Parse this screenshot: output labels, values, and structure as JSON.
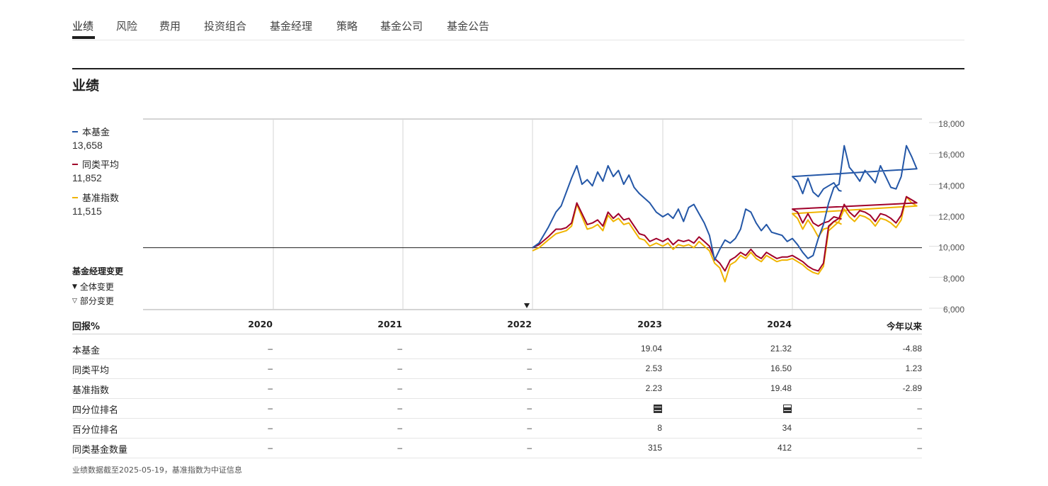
{
  "tabs": [
    "业绩",
    "风险",
    "费用",
    "投资组合",
    "基金经理",
    "策略",
    "基金公司",
    "基金公告"
  ],
  "section_title": "业绩",
  "legend": [
    {
      "name": "本基金",
      "value": "13,658",
      "color": "#2457a7"
    },
    {
      "name": "同类平均",
      "value": "11,852",
      "color": "#a0002a"
    },
    {
      "name": "基准指数",
      "value": "11,515",
      "color": "#f0b400"
    }
  ],
  "manager_change": {
    "title": "基金经理变更",
    "full": "全体变更",
    "partial": "部分变更",
    "full_marker_year": "2022"
  },
  "chart_data": {
    "type": "line",
    "x_labels": [
      "2020",
      "2021",
      "2022",
      "2023",
      "2024",
      "今年以来"
    ],
    "y_ticks": [
      "18,000",
      "16,000",
      "14,000",
      "12,000",
      "10,000",
      "8,000",
      "6,000"
    ],
    "ylim": [
      6000,
      18000
    ],
    "baseline": 10000,
    "series": [
      {
        "name": "本基金",
        "color": "#2457a7",
        "x": [
          2022.0,
          2022.05,
          2022.12,
          2022.18,
          2022.22,
          2022.26,
          2022.3,
          2022.34,
          2022.38,
          2022.42,
          2022.46,
          2022.5,
          2022.54,
          2022.58,
          2022.62,
          2022.66,
          2022.7,
          2022.74,
          2022.78,
          2022.82,
          2022.86,
          2022.9,
          2022.95,
          2023.0,
          2023.04,
          2023.08,
          2023.12,
          2023.16,
          2023.2,
          2023.24,
          2023.28,
          2023.32,
          2023.36,
          2023.4,
          2023.44,
          2023.48,
          2023.52,
          2023.56,
          2023.6,
          2023.64,
          2023.68,
          2023.72,
          2023.76,
          2023.8,
          2023.84,
          2023.88,
          2023.92,
          2023.96,
          2024.0,
          2024.04,
          2024.08,
          2024.12,
          2024.16,
          2024.2,
          2024.24,
          2024.28,
          2024.32,
          2024.36,
          2024.4,
          2024.44,
          2024.48,
          2024.52,
          2024.56,
          2024.6,
          2024.64,
          2024.68,
          2024.72,
          2024.76,
          2024.8,
          2024.84,
          2024.88,
          2024.92,
          2024.96,
          2025.0,
          2025.04,
          2025.08,
          2025.12,
          2025.16,
          2025.2,
          2025.24,
          2025.28,
          2025.32,
          2025.36,
          2025.38
        ],
        "y": [
          10000,
          10300,
          11300,
          12300,
          12700,
          13600,
          14500,
          15300,
          14100,
          14400,
          14000,
          14900,
          14300,
          15300,
          14600,
          15000,
          14100,
          14700,
          13900,
          13500,
          13200,
          12900,
          12300,
          12000,
          12200,
          11900,
          12500,
          11700,
          12600,
          12800,
          12200,
          11600,
          10800,
          9200,
          9900,
          10500,
          10300,
          10600,
          11200,
          12500,
          12300,
          11600,
          11100,
          11500,
          11000,
          10900,
          10800,
          10400,
          10600,
          10200,
          9700,
          9300,
          9500,
          10600,
          11500,
          12900,
          13900,
          14100,
          16600,
          15200,
          14800,
          14300,
          15000,
          14600,
          14200,
          15300,
          14600,
          13900,
          13800,
          14600,
          16600,
          15900,
          15100,
          14600,
          14300,
          13500,
          14500,
          13600,
          13300,
          13800,
          14000,
          14200,
          13700,
          13658
        ]
      },
      {
        "name": "同类平均",
        "color": "#a0002a",
        "x": [
          2022.0,
          2022.05,
          2022.12,
          2022.18,
          2022.22,
          2022.26,
          2022.3,
          2022.34,
          2022.38,
          2022.42,
          2022.46,
          2022.5,
          2022.54,
          2022.58,
          2022.62,
          2022.66,
          2022.7,
          2022.74,
          2022.78,
          2022.82,
          2022.86,
          2022.9,
          2022.95,
          2023.0,
          2023.04,
          2023.08,
          2023.12,
          2023.16,
          2023.2,
          2023.24,
          2023.28,
          2023.32,
          2023.36,
          2023.4,
          2023.44,
          2023.48,
          2023.52,
          2023.56,
          2023.6,
          2023.64,
          2023.68,
          2023.72,
          2023.76,
          2023.8,
          2023.84,
          2023.88,
          2023.92,
          2023.96,
          2024.0,
          2024.04,
          2024.08,
          2024.12,
          2024.16,
          2024.2,
          2024.24,
          2024.28,
          2024.32,
          2024.36,
          2024.4,
          2024.44,
          2024.48,
          2024.52,
          2024.56,
          2024.6,
          2024.64,
          2024.68,
          2024.72,
          2024.76,
          2024.8,
          2024.84,
          2024.88,
          2024.92,
          2024.96,
          2025.0,
          2025.04,
          2025.08,
          2025.12,
          2025.16,
          2025.2,
          2025.24,
          2025.28,
          2025.32,
          2025.36,
          2025.38
        ],
        "y": [
          10000,
          10200,
          10700,
          11200,
          11200,
          11300,
          11600,
          12900,
          12200,
          11500,
          11600,
          11800,
          11400,
          12300,
          11900,
          12200,
          11800,
          11900,
          11400,
          10900,
          10800,
          10400,
          10600,
          10400,
          10600,
          10200,
          10500,
          10400,
          10500,
          10300,
          10700,
          10400,
          10100,
          9300,
          9000,
          8500,
          9200,
          9400,
          9700,
          9500,
          9900,
          9500,
          9300,
          9700,
          9500,
          9300,
          9400,
          9400,
          9500,
          9300,
          9100,
          8800,
          8600,
          8500,
          9000,
          11400,
          11700,
          11900,
          12800,
          12300,
          12000,
          12400,
          12300,
          12100,
          11700,
          12200,
          12100,
          11900,
          11600,
          12100,
          13300,
          13100,
          12900,
          12500,
          12300,
          11600,
          12200,
          11600,
          11400,
          11600,
          11700,
          12000,
          11900,
          11852
        ]
      },
      {
        "name": "基准指数",
        "color": "#f0b400",
        "x": [
          2022.0,
          2022.05,
          2022.12,
          2022.18,
          2022.22,
          2022.26,
          2022.3,
          2022.34,
          2022.38,
          2022.42,
          2022.46,
          2022.5,
          2022.54,
          2022.58,
          2022.62,
          2022.66,
          2022.7,
          2022.74,
          2022.78,
          2022.82,
          2022.86,
          2022.9,
          2022.95,
          2023.0,
          2023.04,
          2023.08,
          2023.12,
          2023.16,
          2023.2,
          2023.24,
          2023.28,
          2023.32,
          2023.36,
          2023.4,
          2023.44,
          2023.48,
          2023.52,
          2023.56,
          2023.6,
          2023.64,
          2023.68,
          2023.72,
          2023.76,
          2023.8,
          2023.84,
          2023.88,
          2023.92,
          2023.96,
          2024.0,
          2024.04,
          2024.08,
          2024.12,
          2024.16,
          2024.2,
          2024.24,
          2024.28,
          2024.32,
          2024.36,
          2024.4,
          2024.44,
          2024.48,
          2024.52,
          2024.56,
          2024.6,
          2024.64,
          2024.68,
          2024.72,
          2024.76,
          2024.8,
          2024.84,
          2024.88,
          2024.92,
          2024.96,
          2025.0,
          2025.04,
          2025.08,
          2025.12,
          2025.16,
          2025.2,
          2025.24,
          2025.28,
          2025.32,
          2025.36,
          2025.38
        ],
        "y": [
          9800,
          10000,
          10500,
          10900,
          11000,
          11100,
          11400,
          12800,
          12000,
          11200,
          11300,
          11500,
          11100,
          12100,
          11700,
          11900,
          11500,
          11600,
          11100,
          10600,
          10500,
          10100,
          10300,
          10100,
          10300,
          9900,
          10200,
          10100,
          10200,
          10000,
          10400,
          10100,
          9800,
          9000,
          8700,
          7800,
          8900,
          9100,
          9500,
          9300,
          9700,
          9300,
          9100,
          9500,
          9300,
          9100,
          9200,
          9200,
          9300,
          9100,
          8900,
          8600,
          8400,
          8300,
          8800,
          11100,
          11400,
          11700,
          12500,
          12000,
          11700,
          12100,
          12000,
          11800,
          11400,
          11900,
          11800,
          11600,
          11300,
          11800,
          13300,
          12900,
          12700,
          12200,
          11900,
          11200,
          11800,
          11300,
          10700,
          11200,
          11300,
          11700,
          11600,
          11515
        ]
      }
    ]
  },
  "table": {
    "header_label": "回报%",
    "columns": [
      "2020",
      "2021",
      "2022",
      "2023",
      "2024",
      "今年以来"
    ],
    "rows": [
      {
        "label": "本基金",
        "values": [
          "–",
          "–",
          "–",
          "19.04",
          "21.32",
          "-4.88"
        ]
      },
      {
        "label": "同类平均",
        "values": [
          "–",
          "–",
          "–",
          "2.53",
          "16.50",
          "1.23"
        ]
      },
      {
        "label": "基准指数",
        "values": [
          "–",
          "–",
          "–",
          "2.23",
          "19.48",
          "-2.89"
        ]
      },
      {
        "label": "四分位排名",
        "values": [
          "–",
          "–",
          "–",
          "",
          "",
          "–"
        ]
      },
      {
        "label": "百分位排名",
        "values": [
          "–",
          "–",
          "–",
          "8",
          "34",
          "–"
        ]
      },
      {
        "label": "同类基金数量",
        "values": [
          "–",
          "–",
          "–",
          "315",
          "412",
          "–"
        ]
      }
    ],
    "quartile_icons": [
      {
        "year": "2023",
        "quartile": 1
      },
      {
        "year": "2024",
        "quartile": 2
      }
    ]
  },
  "footnote": "业绩数据截至2025-05-19，基准指数为中证信息"
}
